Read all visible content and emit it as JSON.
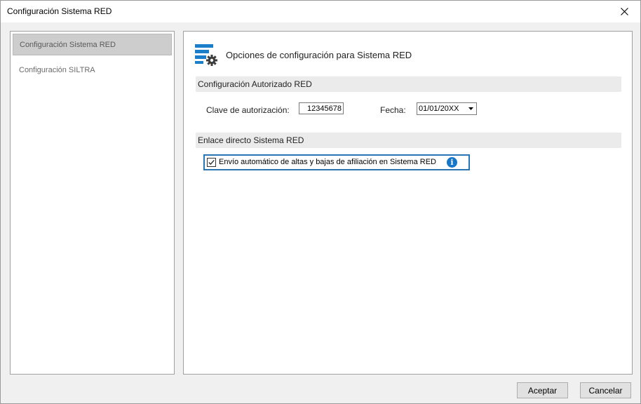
{
  "window": {
    "title": "Configuración Sistema RED"
  },
  "sidebar": {
    "items": [
      {
        "label": "Configuración Sistema RED"
      },
      {
        "label": "Configuración SILTRA"
      }
    ]
  },
  "main": {
    "header": "Opciones de configuración para Sistema RED",
    "header_icon": "settings-list-icon",
    "section_auth": {
      "title": "Configuración Autorizado RED",
      "key_label": "Clave de autorización:",
      "key_value": "12345678",
      "date_label": "Fecha:",
      "date_value": "01/01/20XX"
    },
    "section_link": {
      "title": "Enlace directo Sistema RED",
      "checkbox_label": "Envío automático de altas y bajas de afiliación en Sistema RED",
      "checkbox_checked": true
    }
  },
  "footer": {
    "accept_label": "Aceptar",
    "cancel_label": "Cancelar"
  },
  "colors": {
    "accent": "#2a76b5",
    "info": "#1677c9"
  }
}
